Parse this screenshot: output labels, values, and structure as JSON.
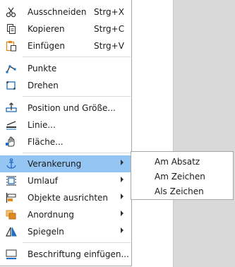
{
  "context_menu": {
    "items": [
      {
        "label": "Ausschneiden",
        "shortcut": "Strg+X",
        "icon": "scissors-icon"
      },
      {
        "label": "Kopieren",
        "shortcut": "Strg+C",
        "icon": "copy-icon"
      },
      {
        "label": "Einfügen",
        "shortcut": "Strg+V",
        "icon": "paste-icon"
      },
      {
        "label": "Punkte",
        "icon": "points-icon"
      },
      {
        "label": "Drehen",
        "icon": "rotate-icon"
      },
      {
        "label": "Position und Größe...",
        "icon": "position-size-icon"
      },
      {
        "label": "Linie...",
        "icon": "line-icon"
      },
      {
        "label": "Fläche...",
        "icon": "area-icon"
      },
      {
        "label": "Verankerung",
        "icon": "anchor-icon",
        "highlighted": true
      },
      {
        "label": "Umlauf",
        "icon": "wrap-icon"
      },
      {
        "label": "Objekte ausrichten",
        "icon": "align-icon"
      },
      {
        "label": "Anordnung",
        "icon": "arrange-icon"
      },
      {
        "label": "Spiegeln",
        "icon": "flip-icon"
      },
      {
        "label": "Beschriftung einfügen...",
        "icon": "caption-icon"
      }
    ]
  },
  "submenu": {
    "items": [
      {
        "label": "Am Absatz"
      },
      {
        "label": "Am Zeichen"
      },
      {
        "label": "Als Zeichen"
      }
    ]
  },
  "colors": {
    "highlight": "#95c5f2",
    "icon_blue": "#1e6fc2",
    "icon_orange": "#e08a1e",
    "gutter": "#d9d9d9"
  }
}
